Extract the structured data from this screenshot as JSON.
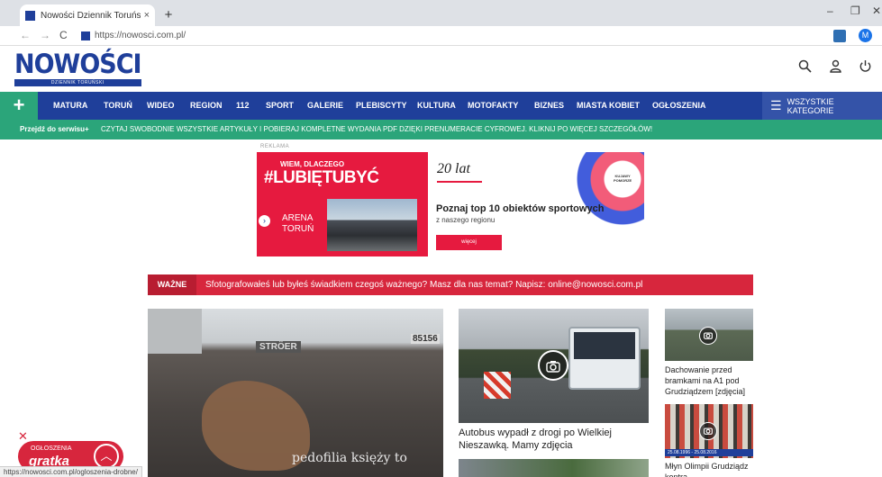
{
  "browser": {
    "tab_title": "Nowości Dziennik Toruński - Dzi",
    "tab_close": "×",
    "new_tab": "+",
    "url": "https://nowosci.com.pl/",
    "profile_initial": "M",
    "back": "←",
    "forward": "→",
    "reload": "C",
    "minimize": "–",
    "maximize": "❐",
    "close_window": "✕",
    "status_url": "https://nowosci.com.pl/ogloszenia-drobne/"
  },
  "header": {
    "logo_text": "NOWOŚCI",
    "logo_sub": "DZIENNIK TORUŃSKI",
    "search_icon": "🔍",
    "user_icon": "👤",
    "power_icon": "⏻"
  },
  "nav": {
    "plus": "+",
    "items": [
      "MATURA",
      "TORUŃ",
      "WIDEO",
      "REGION",
      "112",
      "SPORT",
      "GALERIE",
      "PLEBISCYTY",
      "KULTURA",
      "MOTOFAKTY",
      "BIZNES",
      "MIASTA KOBIET",
      "OGŁOSZENIA"
    ],
    "all_categories": "WSZYSTKIE KATEGORIE",
    "burger": "☰"
  },
  "promo": {
    "left": "Przejdź do serwisu+",
    "text": "CZYTAJ SWOBODNIE WSZYSTKIE ARTYKUŁY I POBIERAJ KOMPLETNE WYDANIA PDF DZIĘKI PRENUMERACIE CYFROWEJ. KLIKNIJ PO WIĘCEJ SZCZEGÓŁÓW!"
  },
  "ad": {
    "label": "REKLAMA",
    "small": "WIEM, DLACZEGO",
    "big": "#LUBIĘTUBYĆ",
    "arena_1": "ARENA",
    "arena_2": "TORUŃ",
    "years": "20 lat",
    "headline": "Poznaj top 10 obiektów sportowych",
    "region": "z naszego regionu",
    "button": "więcej",
    "kujawy_1": "KUJAWY",
    "kujawy_2": "POMORZE",
    "arrow": "›"
  },
  "wazne": {
    "label": "WAŻNE",
    "text": "Sfotografowałeś lub byłeś świadkiem czegoś ważnego? Masz dla nas temat? Napisz: online@nowosci.com.pl"
  },
  "articles": {
    "big": {
      "stroer": "STRÖER",
      "number": "85156",
      "caption": "pedofilia księży to"
    },
    "mid": {
      "title": "Autobus wypadł z drogi po Wielkiej Nieszawką. Mamy zdjęcia",
      "camera": "📷"
    },
    "side": [
      {
        "title": "Dachowanie przed bramkami na A1 pod Grudziądzem [zdjęcia]",
        "camera": "📷"
      },
      {
        "title": "Młyn Olimpii Grudziądz kontra",
        "camera": "📷",
        "date_strip": "25.08.1996 - 25.08.2016"
      }
    ]
  },
  "classifieds": {
    "close": "✕",
    "top": "OGŁOSZENIA",
    "brand": "gratka",
    "up": "︿"
  },
  "colors": {
    "brand_blue": "#1f3f9a",
    "green": "#2ba57a",
    "red": "#d7263d"
  }
}
